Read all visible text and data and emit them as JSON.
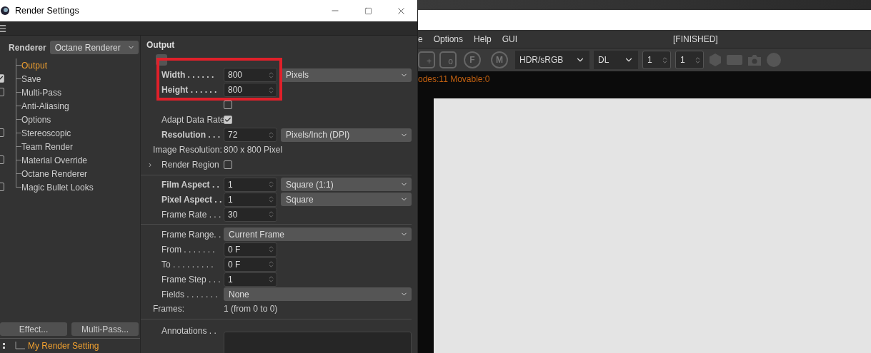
{
  "window": {
    "title": "Render Settings"
  },
  "sidebar": {
    "renderer_label": "Renderer",
    "renderer_value": "Octane Renderer",
    "items": [
      {
        "label": "Output",
        "kind": "plain",
        "selected": true
      },
      {
        "label": "Save",
        "kind": "checkbox",
        "checked": true,
        "selected": false
      },
      {
        "label": "Multi-Pass",
        "kind": "checkbox",
        "checked": false,
        "selected": false
      },
      {
        "label": "Anti-Aliasing",
        "kind": "plain",
        "selected": false
      },
      {
        "label": "Options",
        "kind": "plain",
        "selected": false
      },
      {
        "label": "Stereoscopic",
        "kind": "checkbox",
        "checked": false,
        "selected": false
      },
      {
        "label": "Team Render",
        "kind": "plain",
        "selected": false
      },
      {
        "label": "Material Override",
        "kind": "checkbox",
        "checked": false,
        "selected": false
      },
      {
        "label": "Octane Renderer",
        "kind": "plain",
        "selected": false
      },
      {
        "label": "Magic Bullet Looks",
        "kind": "checkbox",
        "checked": false,
        "selected": false
      }
    ],
    "buttons": [
      "Effect...",
      "Multi-Pass..."
    ],
    "preset": "My Render Setting"
  },
  "panel": {
    "title": "Output",
    "rows": [
      {
        "kind": "toggle"
      },
      {
        "kind": "field",
        "label": "Width . . . . . .",
        "bold": true,
        "value": "800",
        "dropdown": "Pixels"
      },
      {
        "kind": "field",
        "label": "Height . . . . . .",
        "bold": true,
        "value": "800"
      },
      {
        "kind": "checkbox",
        "checked": false
      },
      {
        "kind": "checkbox",
        "label": "Adapt Data Rate",
        "checked": true
      },
      {
        "kind": "field",
        "label": "Resolution . . .",
        "bold": true,
        "value": "72",
        "dropdown": "Pixels/Inch (DPI)"
      },
      {
        "kind": "info",
        "label": "Image Resolution:",
        "value": "800 x 800 Pixel"
      },
      {
        "kind": "checkbox",
        "label": "Render Region",
        "checked": false,
        "expander": "›"
      },
      {
        "kind": "divider"
      },
      {
        "kind": "field",
        "label": "Film Aspect . .",
        "bold": true,
        "value": "1",
        "dropdown": "Square (1:1)"
      },
      {
        "kind": "field",
        "label": "Pixel Aspect . .",
        "bold": true,
        "value": "1",
        "dropdown": "Square"
      },
      {
        "kind": "field",
        "label": "Frame Rate . . .",
        "bold": false,
        "value": "30"
      },
      {
        "kind": "divider"
      },
      {
        "kind": "select",
        "label": "Frame Range. .",
        "value": "Current Frame"
      },
      {
        "kind": "field",
        "label": "From . . . . . . .",
        "bold": false,
        "value": "0 F"
      },
      {
        "kind": "field",
        "label": "To . . . . . . . . .",
        "bold": false,
        "value": "0 F"
      },
      {
        "kind": "field",
        "label": "Frame Step . . .",
        "bold": false,
        "value": "1"
      },
      {
        "kind": "select",
        "label": "Fields . . . . . . .",
        "value": "None"
      },
      {
        "kind": "info",
        "label": "Frames:",
        "value": "1 (from 0 to 0)"
      },
      {
        "kind": "divider"
      },
      {
        "kind": "textarea",
        "label": "Annotations . ."
      }
    ]
  },
  "viewer": {
    "menu": [
      "e",
      "Options",
      "Help",
      "GUI"
    ],
    "status": "[FINISHED]",
    "tool_buttons": [
      {
        "kind": "square",
        "label": "+"
      },
      {
        "kind": "square",
        "label": "o"
      },
      {
        "kind": "pin",
        "label": "F"
      },
      {
        "kind": "pin",
        "label": "M"
      }
    ],
    "selects": [
      "HDR/sRGB",
      "DL"
    ],
    "spinners": [
      "1",
      "1"
    ],
    "log": "odes:11 Movable:0"
  }
}
